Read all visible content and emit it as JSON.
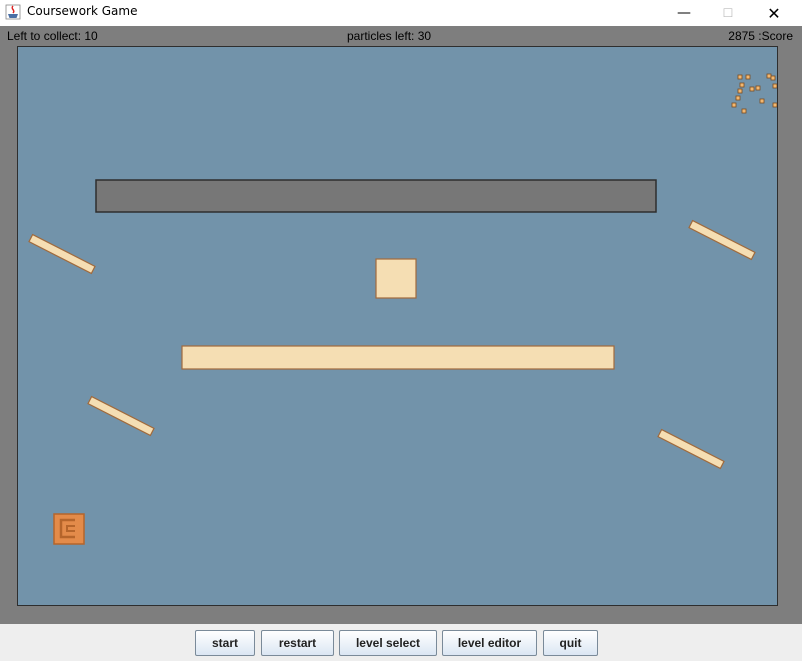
{
  "window": {
    "title": "Coursework Game",
    "minimize_glyph": "—",
    "maximize_glyph": "☐",
    "close_glyph": "✕",
    "app_icon": "java-cup-icon"
  },
  "status": {
    "left_to_collect": "Left to collect: 10",
    "particles_left": "particles left: 30",
    "score": "2875 :Score"
  },
  "colors": {
    "playfield": "#7293aa",
    "border": "#7e7e7e",
    "platform": "#f5deb3",
    "solid_block": "#777777",
    "goal": "#e38b4a",
    "particle": "#f2b871"
  },
  "buttons": {
    "start": "start",
    "restart": "restart",
    "level_select": "level select",
    "level_editor": "level editor",
    "quit": "quit"
  }
}
